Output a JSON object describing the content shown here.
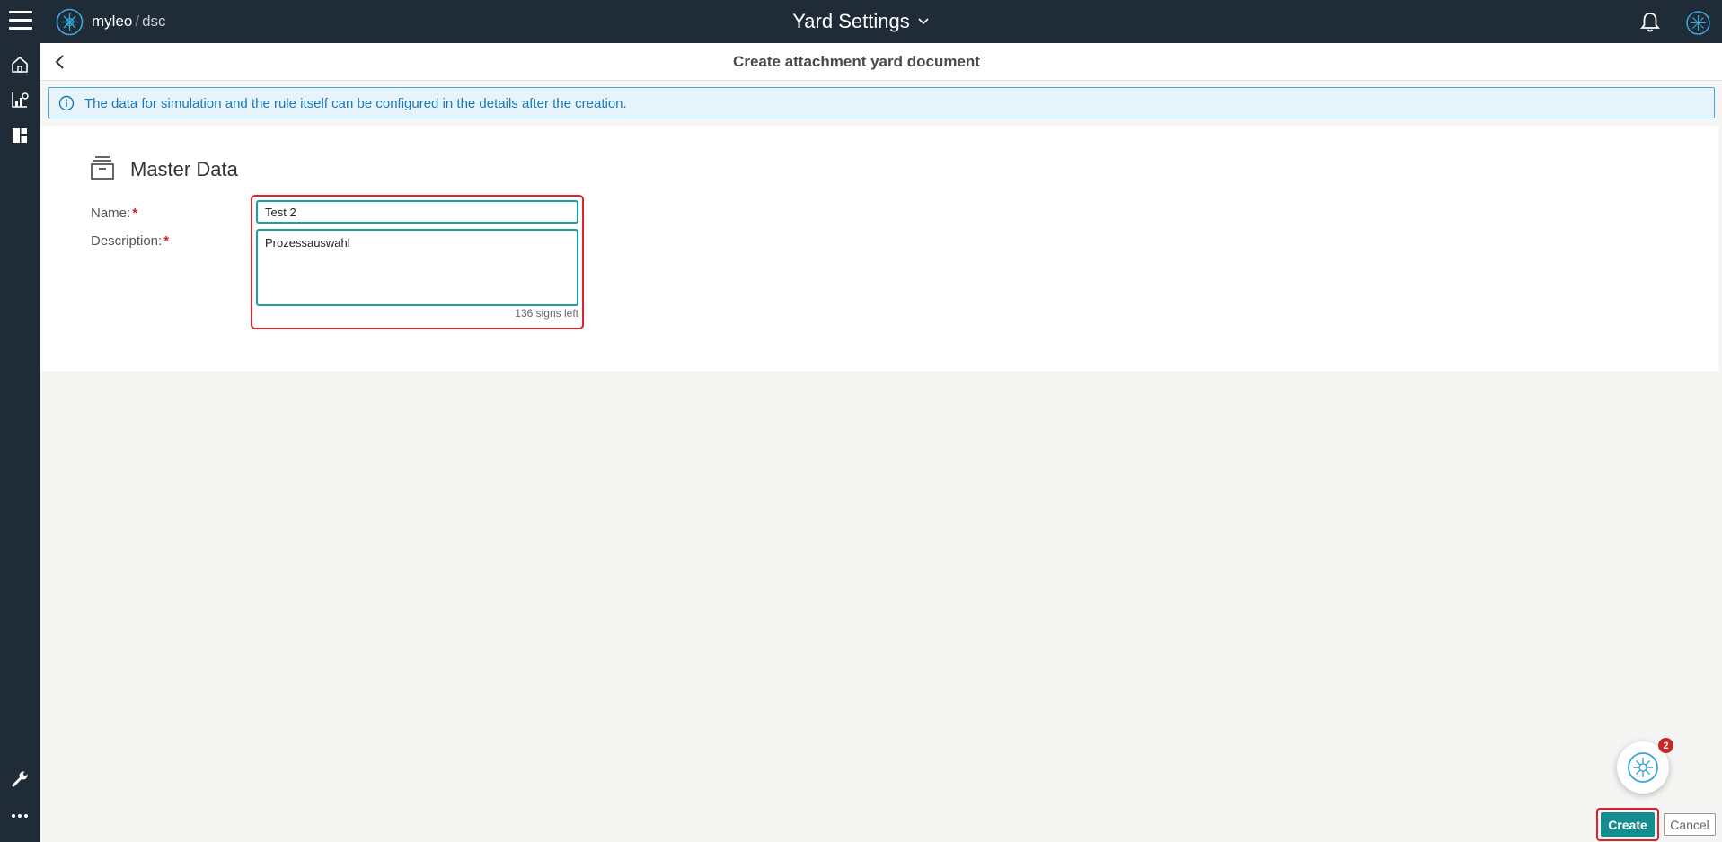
{
  "topbar": {
    "brand_main": "myleo",
    "brand_sep": "/",
    "brand_product": "dsc",
    "app_title": "Yard Settings"
  },
  "page": {
    "title": "Create attachment yard document"
  },
  "info": {
    "text": "The data for simulation and the rule itself can be configured in the details after the creation."
  },
  "master": {
    "section_title": "Master Data",
    "name_label": "Name:",
    "desc_label": "Description:",
    "required_mark": "*",
    "name_value": "Test 2",
    "desc_value": "Prozessauswahl",
    "char_count": "136 signs left"
  },
  "assistant": {
    "badge_count": "2"
  },
  "actions": {
    "create_label": "Create",
    "cancel_label": "Cancel"
  },
  "colors": {
    "topbar_bg": "#1f2b36",
    "accent_teal": "#138d8d",
    "input_border": "#17a3a3",
    "highlight_red": "#e0202a",
    "info_bg": "#e6f3fb",
    "info_text": "#1e78b4"
  },
  "icons": {
    "menu": "hamburger-menu-icon",
    "logo": "myleo-logo-icon",
    "dropdown": "chevron-down-icon",
    "bell": "notification-bell-icon",
    "avatar": "user-avatar-icon",
    "home": "home-icon",
    "analytics": "analytics-icon",
    "dashboard": "dashboard-icon",
    "tools": "wrench-icon",
    "more": "more-horizontal-icon",
    "back": "chevron-left-icon",
    "info": "info-icon",
    "section": "archive-box-icon",
    "assistant": "assistant-icon"
  }
}
